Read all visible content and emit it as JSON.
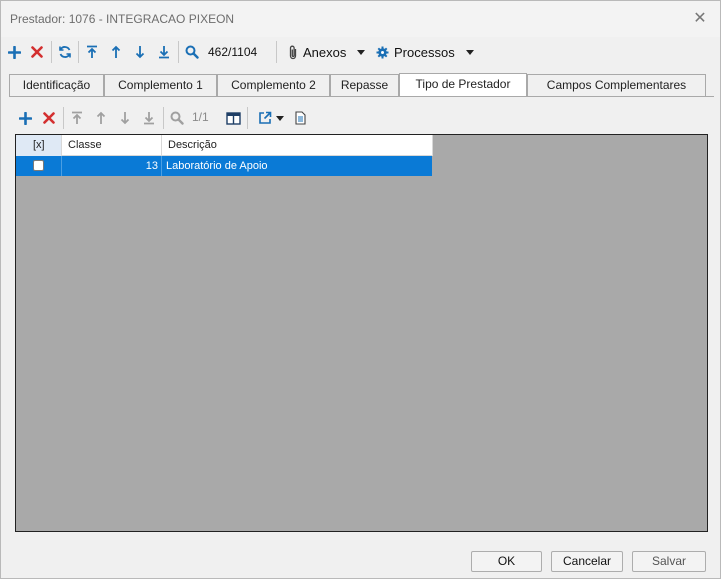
{
  "window": {
    "title": "Prestador: 1076 - INTEGRACAO PIXEON",
    "close_glyph": "✕"
  },
  "toolbar": {
    "icons": [
      "add-icon",
      "delete-icon",
      "refresh-icon",
      "first-icon",
      "up-icon",
      "down-icon",
      "last-icon",
      "search-icon"
    ],
    "record_counter": "462/1104",
    "attachments_label": "Anexos",
    "processes_label": "Processos"
  },
  "tabs": [
    {
      "label": "Identificação",
      "active": false
    },
    {
      "label": "Complemento 1",
      "active": false
    },
    {
      "label": "Complemento 2",
      "active": false
    },
    {
      "label": "Repasse",
      "active": false
    },
    {
      "label": "Tipo de Prestador",
      "active": true
    },
    {
      "label": "Campos Complementares",
      "active": false
    }
  ],
  "inner_toolbar": {
    "page_counter": "1/1",
    "icons": [
      "add-icon",
      "delete-icon",
      "first-icon",
      "up-icon",
      "down-icon",
      "last-icon",
      "search-icon",
      "columns-icon",
      "export-icon",
      "document-icon"
    ]
  },
  "grid": {
    "columns": [
      "[x]",
      "Classe",
      "Descrição"
    ],
    "rows": [
      {
        "checked": false,
        "classe": "13",
        "descricao": "Laboratório de Apoio",
        "selected": true
      }
    ]
  },
  "footer": {
    "ok_label": "OK",
    "cancel_label": "Cancelar",
    "save_label": "Salvar"
  },
  "colors": {
    "accent_blue": "#0a7ad6",
    "delete_red": "#d32f2f",
    "grid_background": "#a9a9a9",
    "icon_blue": "#1a6fb5"
  }
}
